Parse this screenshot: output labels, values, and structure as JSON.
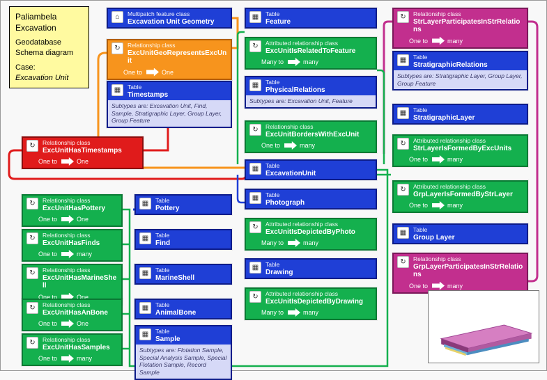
{
  "info": {
    "line1": "Paliambela",
    "line2": "Excavation",
    "line3": "Geodatabase",
    "line4": "Schema diagram",
    "line5": "Case:",
    "line6": "Excavation Unit"
  },
  "palette": {
    "blue": "#1f3fd6",
    "green": "#14b04e",
    "orange": "#f7941d",
    "red": "#e01b1b",
    "magenta": "#c22f8e"
  },
  "cardinality": {
    "one": "One",
    "one_to": "One to",
    "many": "many",
    "many_to": "Many to"
  },
  "nodes": {
    "excGeom": {
      "type": "Multipatch feature class",
      "name": "Excavation Unit Geometry"
    },
    "relGeoRep": {
      "type": "Relationship class",
      "name": "ExcUnitGeoRepresentsExcUnit",
      "card": [
        "One to",
        "One"
      ]
    },
    "tblTimestamps": {
      "type": "Table",
      "name": "Timestamps",
      "sub": "Subtypes are: Excavation Unit, Find, Sample, Stratigraphic Layer, Group Layer, Group Feature"
    },
    "relTimestamps": {
      "type": "Relationship class",
      "name": "ExcUnitHasTimestamps",
      "card": [
        "One to",
        "One"
      ]
    },
    "relPottery": {
      "type": "Relationship class",
      "name": "ExcUnitHasPottery",
      "card": [
        "One to",
        "One"
      ]
    },
    "relFinds": {
      "type": "Relationship class",
      "name": "ExcUnitHasFinds",
      "card": [
        "One to",
        "many"
      ]
    },
    "relMarine": {
      "type": "Relationship class",
      "name": "ExcUnitHasMarineShell",
      "card": [
        "One to",
        "One"
      ]
    },
    "relBone": {
      "type": "Relationship class",
      "name": "ExcUnitHasAnBone",
      "card": [
        "One to",
        "One"
      ]
    },
    "relSamples": {
      "type": "Relationship class",
      "name": "ExcUnitHasSamples",
      "card": [
        "One to",
        "many"
      ]
    },
    "tblPottery": {
      "type": "Table",
      "name": "Pottery"
    },
    "tblFind": {
      "type": "Table",
      "name": "Find"
    },
    "tblMarine": {
      "type": "Table",
      "name": "MarineShell"
    },
    "tblBone": {
      "type": "Table",
      "name": "AnimalBone"
    },
    "tblSample": {
      "type": "Table",
      "name": "Sample",
      "sub": "Subtypes are: Flotation Sample, Special Analysis Sample, Special Flotation Sample, Record Sample"
    },
    "tblFeature": {
      "type": "Table",
      "name": "Feature"
    },
    "arcRelFeature": {
      "type": "Attributed relationship class",
      "name": "ExcUnitIsRelatedToFeature",
      "card": [
        "Many to",
        "many"
      ]
    },
    "tblPhysRel": {
      "type": "Table",
      "name": "PhysicalRelations",
      "sub": "Subtypes are: Excavation Unit, Feature"
    },
    "relBorders": {
      "type": "Relationship class",
      "name": "ExcUnitBordersWithExcUnit",
      "card": [
        "One to",
        "many"
      ]
    },
    "tblExcUnit": {
      "type": "Table",
      "name": "ExcavationUnit"
    },
    "tblPhoto": {
      "type": "Table",
      "name": "Photograph"
    },
    "arcPhoto": {
      "type": "Attributed relationship class",
      "name": "ExcUnitIsDepictedByPhoto",
      "card": [
        "Many to",
        "many"
      ]
    },
    "tblDrawing": {
      "type": "Table",
      "name": "Drawing"
    },
    "arcDrawing": {
      "type": "Attributed relationship class",
      "name": "ExcUnitIsDepictedByDrawing",
      "card": [
        "Many to",
        "many"
      ]
    },
    "relStrPart": {
      "type": "Relationship class",
      "name": "StrLayerParticipatesInStrRelations",
      "card": [
        "One to",
        "many"
      ]
    },
    "tblStrRel": {
      "type": "Table",
      "name": "StratigraphicRelations",
      "sub": "Subtypes are: Stratigraphic Layer, Group Layer, Group Feature"
    },
    "tblStrLayer": {
      "type": "Table",
      "name": "StratigraphicLayer"
    },
    "arcStrFormed": {
      "type": "Attributed relationship class",
      "name": "StrLayerIsFormedByExcUnits",
      "card": [
        "One to",
        "many"
      ]
    },
    "arcGrpFormed": {
      "type": "Attributed relationship class",
      "name": "GrpLayerIsFormedByStrLayer",
      "card": [
        "One to",
        "many"
      ]
    },
    "tblGrpLayer": {
      "type": "Table",
      "name": "Group Layer"
    },
    "relGrpPart": {
      "type": "Relationship class",
      "name": "GrpLayerParticipatesInStrRelations",
      "card": [
        "One to",
        "many"
      ]
    }
  }
}
